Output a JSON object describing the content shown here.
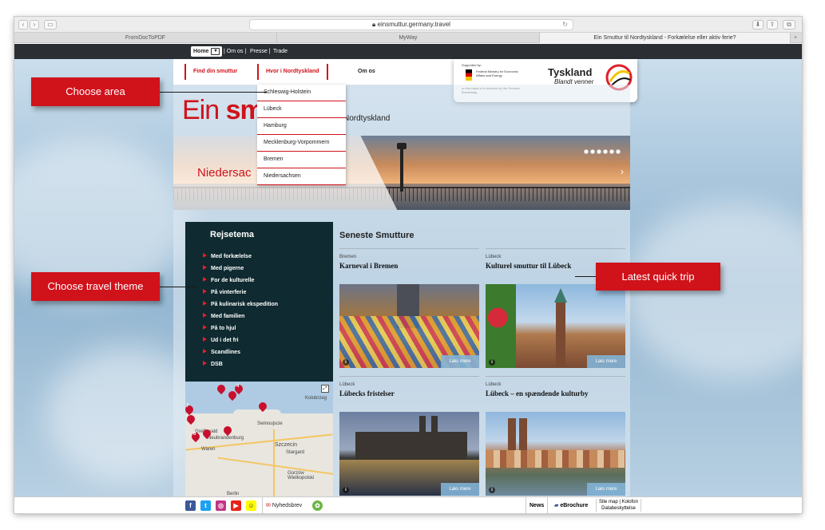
{
  "browser": {
    "url": "einsmuttur.germany.travel",
    "tabs": [
      "FromDocToPDF",
      "MyWay",
      "Ein Smuttur til Nordtyskland - Forkælelse eller aktiv ferie?"
    ]
  },
  "topnav": {
    "home": "Home",
    "links": [
      "Om os",
      "Presse",
      "Trade"
    ]
  },
  "mainnav": {
    "find": "Find din smuttur",
    "where": "Hvor i Nordtyskland",
    "about": "Om os"
  },
  "dropdown": {
    "items": [
      "Schleswig-Holstein",
      "Lübeck",
      "Hamburg",
      "Mecklenburg-Vorpommern",
      "Bremen",
      "Niedersachsen"
    ]
  },
  "logo": {
    "ministry_top": "Supported by:",
    "ministry_name": "Federal Ministry for Economic Affairs and Energy",
    "ministry_bottom": "on the basis of a decision by the German Bundestag",
    "title": "Tyskland",
    "subtitle": "Blandt venner"
  },
  "headline": {
    "part1": "Ein ",
    "part2": "sm",
    "sub": "Nordtyskland"
  },
  "hero": {
    "text": "Niedersac"
  },
  "themes": {
    "title": "Rejsetema",
    "items": [
      "Med forkælelse",
      "Med pigerne",
      "For de kulturelle",
      "På vinterferie",
      "På kulinarisk ekspedition",
      "Med familien",
      "På to hjul",
      "Ud i det fri",
      "Scandlines",
      "DSB"
    ]
  },
  "map": {
    "labels": [
      "Kolobrzeg",
      "Greifswald",
      "Swinoujscie",
      "Szczecin",
      "Stargard",
      "Neubrandenburg",
      "Waren",
      "Gorzów Wielkopolski",
      "Berlin",
      "Kołobrzeg"
    ],
    "pins": [
      "4",
      "7",
      "6"
    ]
  },
  "latest": {
    "title": "Seneste Smutture",
    "read_more": "Læs mere",
    "info": "i",
    "trips": [
      {
        "category": "Bremen",
        "title": "Karneval i Bremen"
      },
      {
        "category": "Lübeck",
        "title": "Kulturel smuttur til Lübeck"
      },
      {
        "category": "Lübeck",
        "title": "Lübecks fristelser"
      },
      {
        "category": "Lübeck",
        "title": "Lübeck – en spændende kulturby"
      }
    ]
  },
  "footer": {
    "newsletter": "Nyhedsbrev",
    "news": "News",
    "ebrochure": "eBrochure",
    "sitemap": "Site map | Kolofon",
    "privacy": "Databeskyttelse"
  },
  "callouts": {
    "area": "Choose area",
    "theme": "Choose travel theme",
    "latest": "Latest quick trip"
  },
  "colors": {
    "accent": "#d0121b",
    "dark_panel": "#0f2a30",
    "topbar": "#2b2f33"
  }
}
